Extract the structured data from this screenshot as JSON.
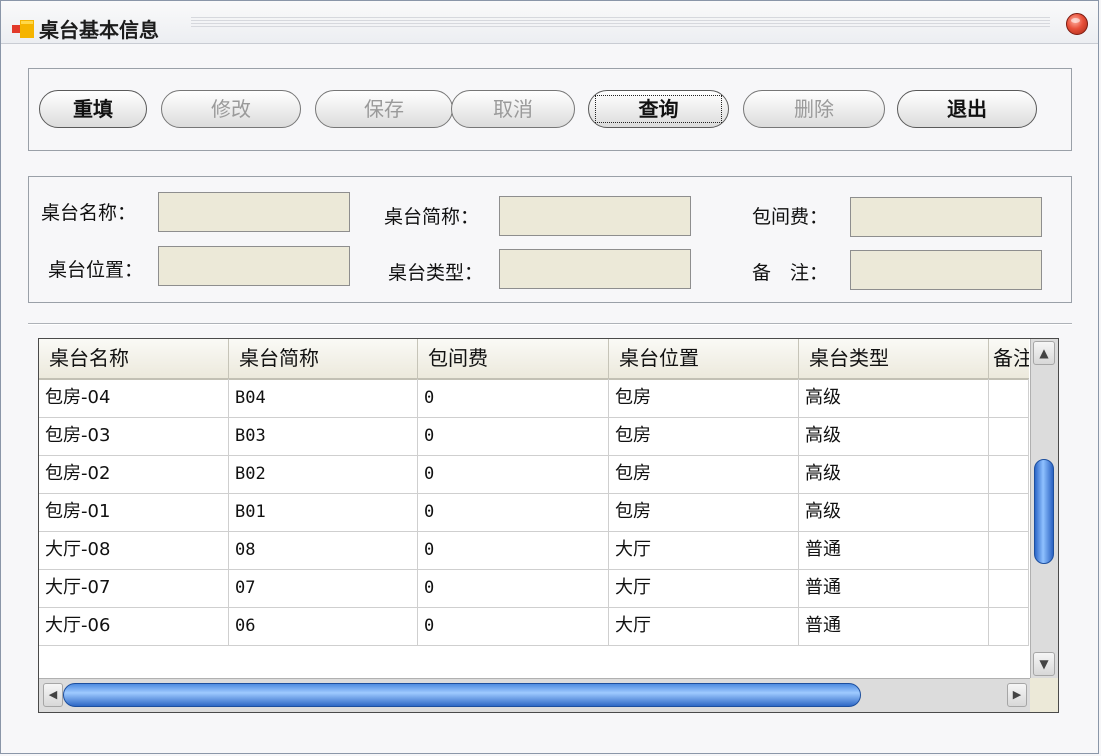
{
  "window": {
    "title": "桌台基本信息"
  },
  "toolbar": {
    "buttons": [
      {
        "label": "重填",
        "enabled": true
      },
      {
        "label": "修改",
        "enabled": false
      },
      {
        "label": "保存",
        "enabled": false
      },
      {
        "label": "取消",
        "enabled": false
      },
      {
        "label": "查询",
        "enabled": true,
        "focused": true
      },
      {
        "label": "删除",
        "enabled": false
      },
      {
        "label": "退出",
        "enabled": true
      }
    ]
  },
  "form": {
    "table_name_label": "桌台名称：",
    "table_name_value": "",
    "table_short_label": "桌台简称：",
    "table_short_value": "",
    "room_fee_label": "包间费：",
    "room_fee_value": "",
    "table_location_label": "桌台位置：",
    "table_location_value": "",
    "table_type_label": "桌台类型：",
    "table_type_value": "",
    "remark_label": "备　注：",
    "remark_value": ""
  },
  "grid": {
    "columns": [
      "桌台名称",
      "桌台简称",
      "包间费",
      "桌台位置",
      "桌台类型",
      "备注"
    ],
    "rows": [
      [
        "包房-04",
        "B04",
        "0",
        "包房",
        "高级",
        ""
      ],
      [
        "包房-03",
        "B03",
        "0",
        "包房",
        "高级",
        ""
      ],
      [
        "包房-02",
        "B02",
        "0",
        "包房",
        "高级",
        ""
      ],
      [
        "包房-01",
        "B01",
        "0",
        "包房",
        "高级",
        ""
      ],
      [
        "大厅-08",
        "08",
        "0",
        "大厅",
        "普通",
        ""
      ],
      [
        "大厅-07",
        "07",
        "0",
        "大厅",
        "普通",
        ""
      ],
      [
        "大厅-06",
        "06",
        "0",
        "大厅",
        "普通",
        ""
      ]
    ]
  },
  "colors": {
    "field_background": "#ece9d8",
    "scroll_thumb": "#4d8be0",
    "close_button": "#e8503a"
  },
  "icons": {
    "app": "app-window-icon",
    "close": "close-icon",
    "scroll_up": "arrow-up-icon",
    "scroll_down": "arrow-down-icon",
    "scroll_left": "arrow-left-icon",
    "scroll_right": "arrow-right-icon"
  }
}
